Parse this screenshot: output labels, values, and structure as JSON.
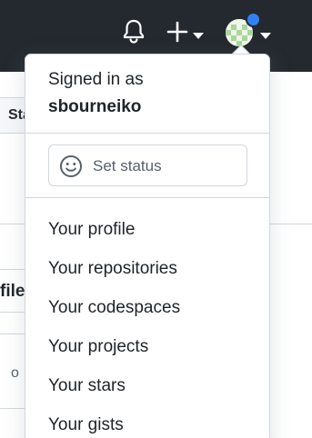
{
  "header": {
    "icons": [
      "bell-icon",
      "plus-icon",
      "chevron-down-icon",
      "avatar",
      "chevron-down-icon"
    ],
    "background_color": "#24292f",
    "notification_dot_color": "#2f81f7"
  },
  "background_page": {
    "fragment_1": "Sta",
    "fragment_2": "file",
    "fragment_3": "o"
  },
  "user_menu": {
    "signed_in_label": "Signed in as",
    "username": "sbourneiko",
    "set_status_label": "Set status",
    "items": [
      {
        "label": "Your profile"
      },
      {
        "label": "Your repositories"
      },
      {
        "label": "Your codespaces"
      },
      {
        "label": "Your projects"
      },
      {
        "label": "Your stars"
      },
      {
        "label": "Your gists"
      }
    ]
  }
}
